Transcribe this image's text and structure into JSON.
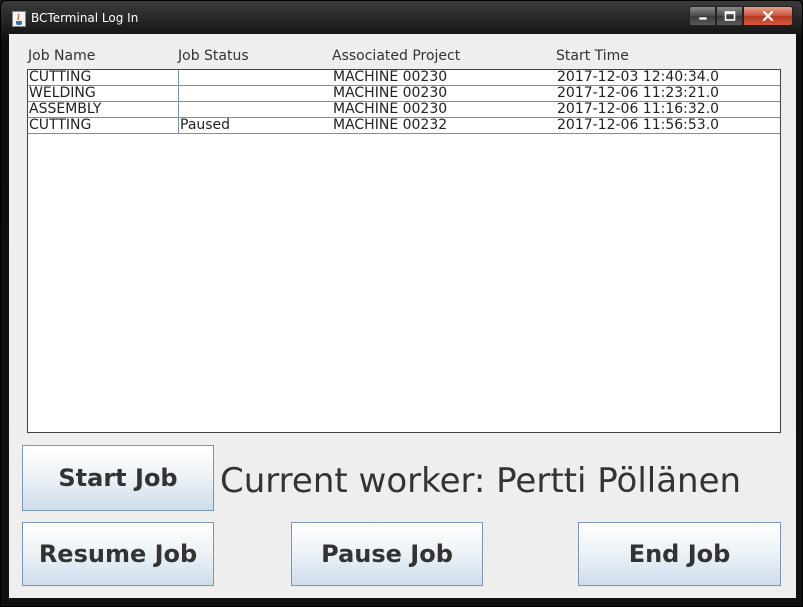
{
  "window": {
    "title": "BCTerminal Log In"
  },
  "table": {
    "columns": [
      "Job Name",
      "Job Status",
      "Associated Project",
      "Start Time"
    ],
    "rows": [
      [
        "CUTTING",
        "",
        "MACHINE 00230",
        "2017-12-03 12:40:34.0"
      ],
      [
        "WELDING",
        "",
        "MACHINE 00230",
        "2017-12-06 11:23:21.0"
      ],
      [
        "ASSEMBLY",
        "",
        "MACHINE 00230",
        "2017-12-06 11:16:32.0"
      ],
      [
        "CUTTING",
        "Paused",
        "MACHINE 00232",
        "2017-12-06 11:56:53.0"
      ]
    ]
  },
  "buttons": {
    "start": "Start Job",
    "resume": "Resume Job",
    "pause": "Pause Job",
    "end": "End Job"
  },
  "worker": {
    "label": "Current worker: Pertti Pöllänen"
  },
  "icons": {
    "app": "java-coffee-cup-icon",
    "minimize": "minimize-icon",
    "maximize": "maximize-icon",
    "close": "close-icon"
  }
}
